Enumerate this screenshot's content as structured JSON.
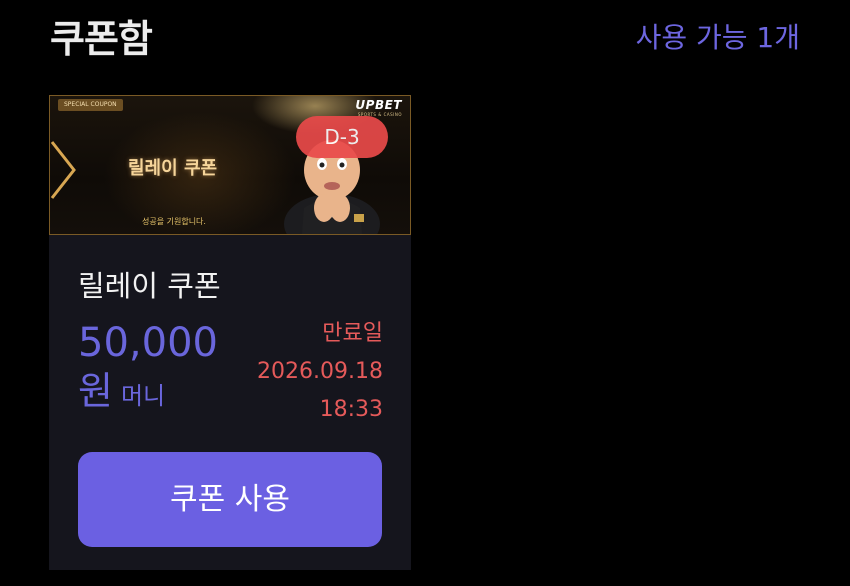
{
  "header": {
    "title": "쿠폰함",
    "available_count": "사용 가능 1개"
  },
  "coupon": {
    "banner": {
      "special_tag": "SPECIAL COUPON",
      "brand": "UPBET",
      "brand_sub": "SPORTS & CASINO",
      "title": "릴레이 쿠폰",
      "subtitle": "성공을 기원합니다.",
      "dday": "D-3"
    },
    "name": "릴레이 쿠폰",
    "amount": "50,000",
    "amount_unit": "원",
    "amount_type": "머니",
    "expiry_label": "만료일",
    "expiry_date": "2026.09.18",
    "expiry_time": "18:33",
    "use_button": "쿠폰 사용"
  },
  "colors": {
    "background": "#000000",
    "accent": "#6b60e2",
    "expiry": "#e55a5a",
    "card": "#15151d"
  }
}
